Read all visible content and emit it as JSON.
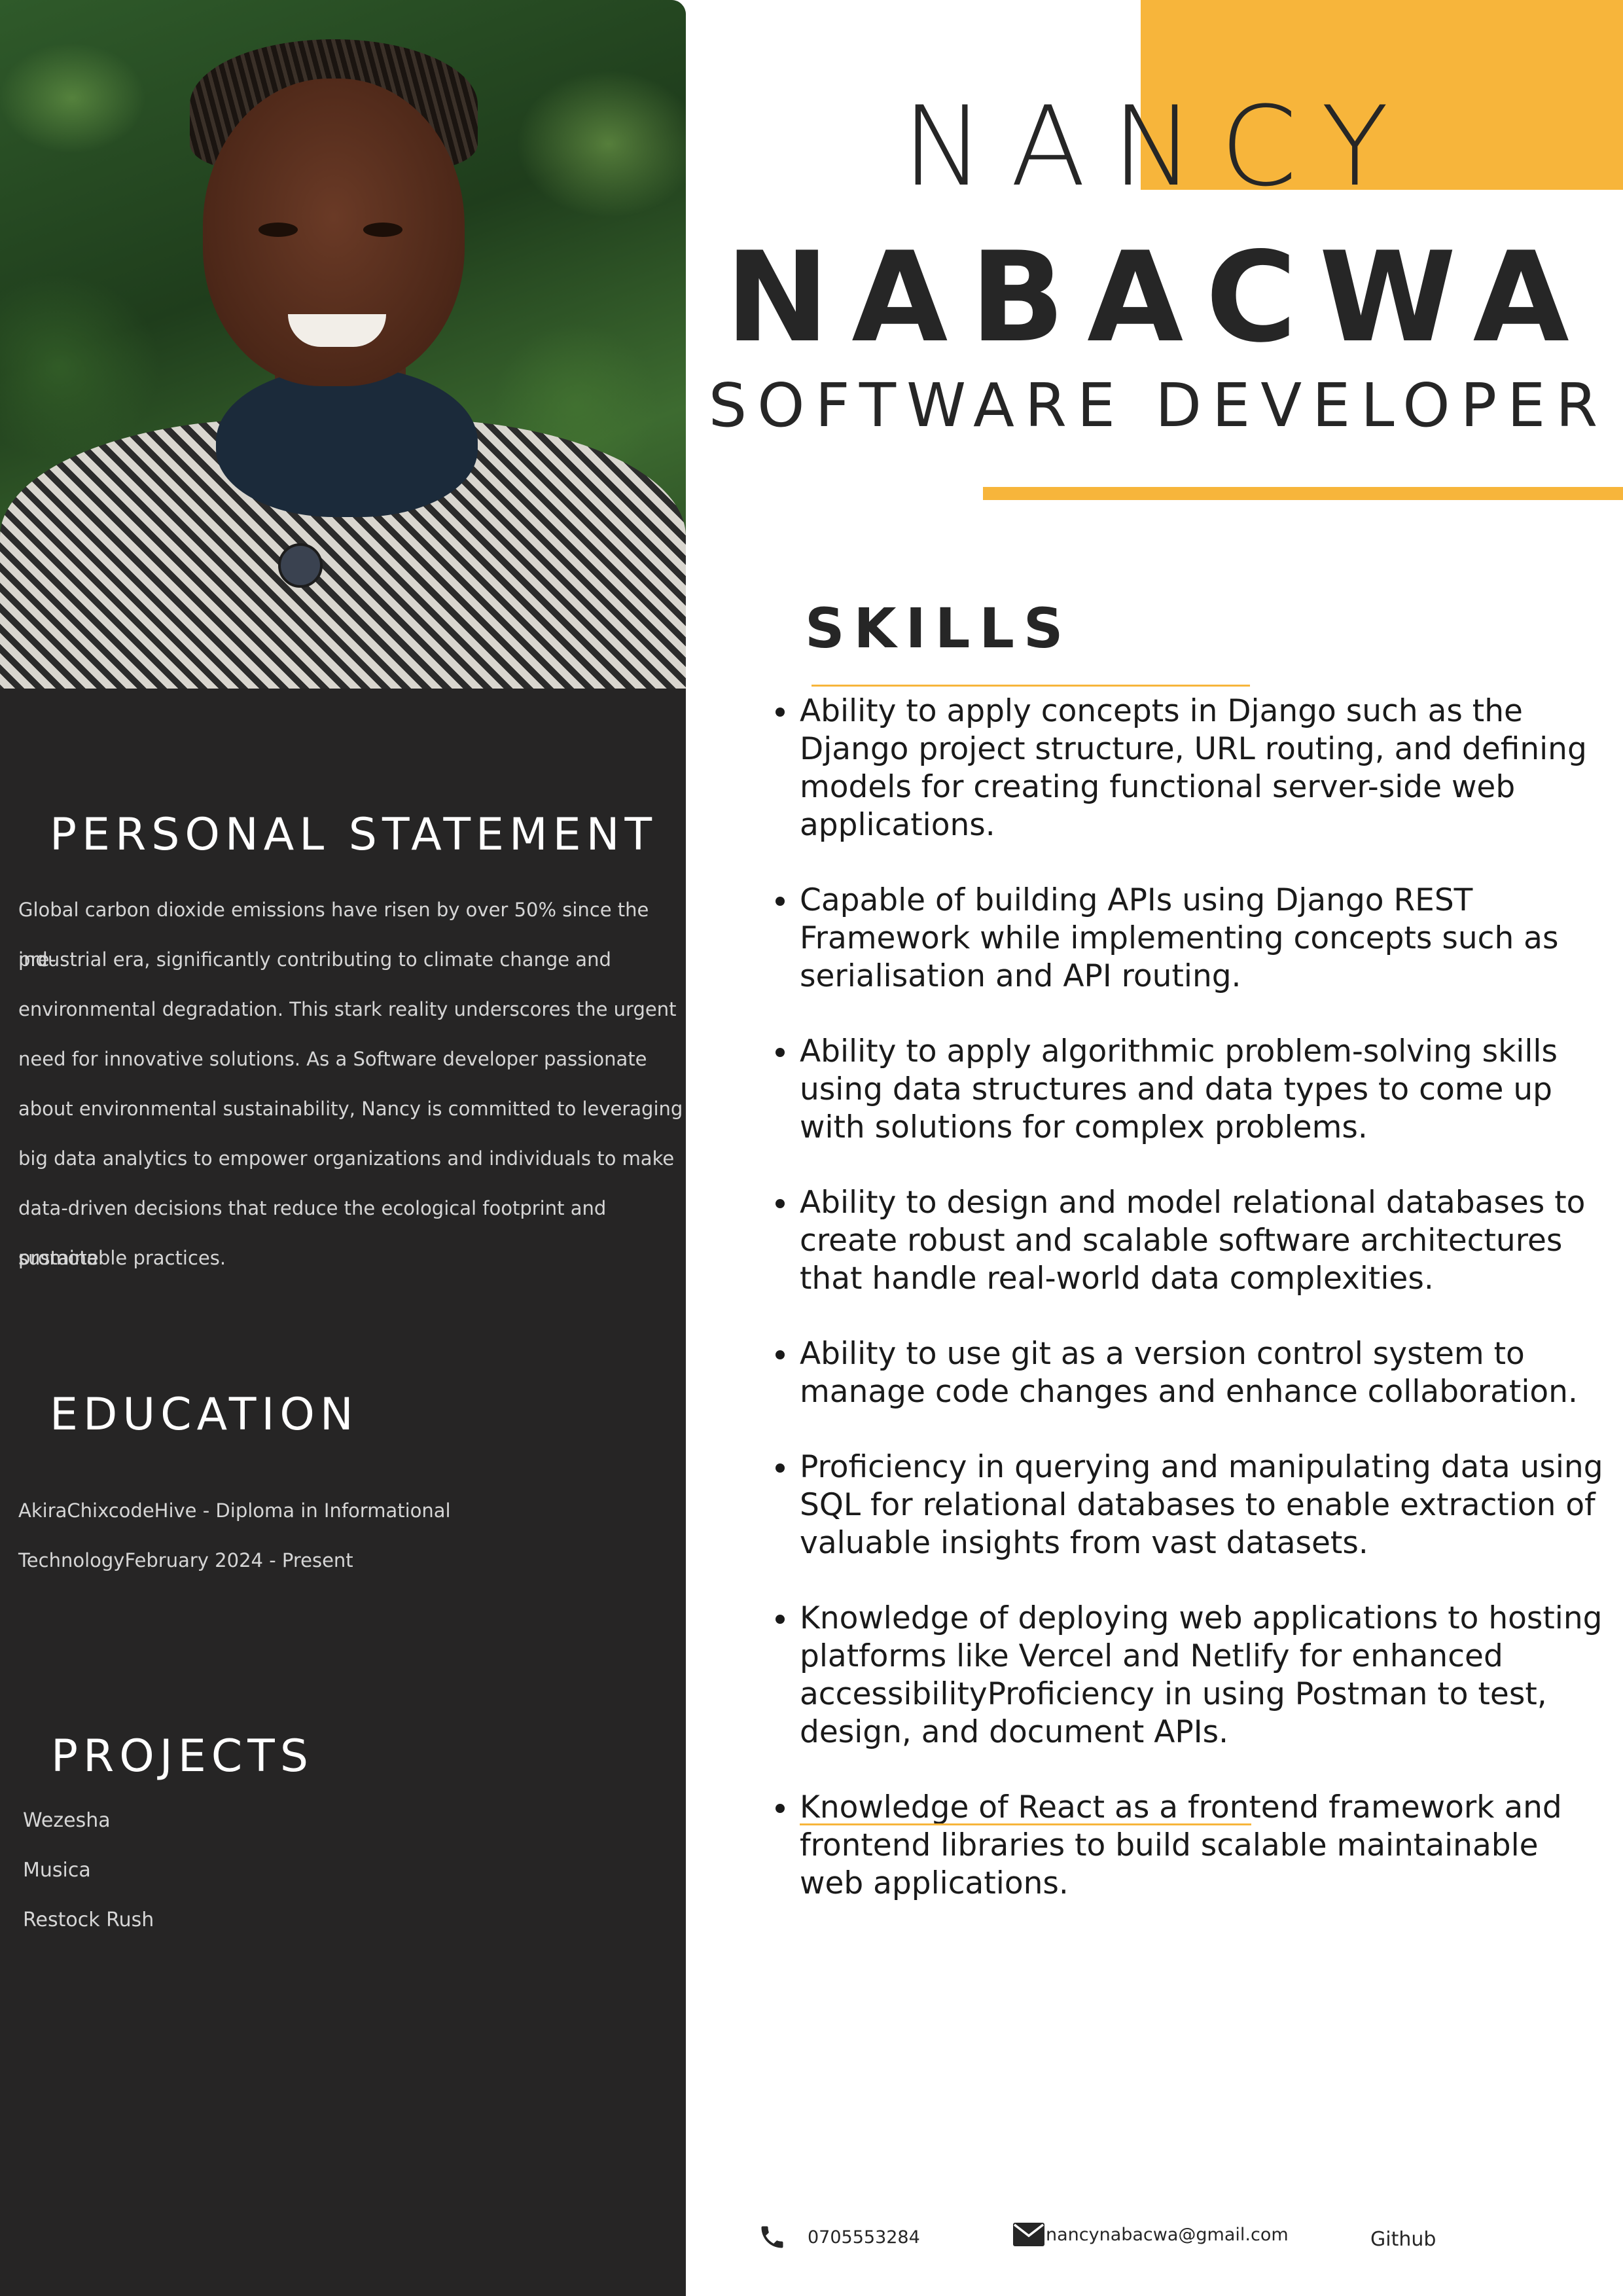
{
  "profile": {
    "first_name": "NANCY",
    "last_name": "NABACWA",
    "title": "SOFTWARE DEVELOPER"
  },
  "personal_statement": {
    "heading": "PERSONAL STATEMENT",
    "lines": [
      "Global carbon dioxide emissions have risen by over 50% since the pre-",
      "industrial era, significantly contributing to climate change and",
      "environmental degradation. This stark reality underscores the urgent",
      "need for innovative solutions. As a Software developer passionate",
      "about environmental sustainability,  Nancy is committed to leveraging",
      "big data analytics to empower organizations and individuals to make",
      "data-driven decisions that reduce the ecological footprint and promote",
      "sustainable practices."
    ]
  },
  "education": {
    "heading": "EDUCATION",
    "lines": [
      "AkiraChixcodeHive - Diploma in Informational",
      "TechnologyFebruary 2024 - Present"
    ]
  },
  "projects": {
    "heading": "PROJECTS",
    "items": [
      "Wezesha",
      "Musica",
      "Restock Rush"
    ]
  },
  "skills": {
    "heading": "SKILLS",
    "items": [
      "Ability to apply concepts in Django such as the Django project structure, URL routing, and defining models for creating functional server-side web applications.",
      "Capable of building APIs using Django REST Framework while implementing concepts such as serialisation and API routing.",
      "Ability to apply algorithmic problem-solving skills using data structures and data types to come up with solutions for complex problems.",
      "Ability to design and model relational databases to create robust and scalable software architectures that handle real-world data complexities.",
      "Ability to use git as a version control system to manage code changes and enhance collaboration.",
      "Proficiency in querying and manipulating data using SQL for relational databases to enable extraction of valuable insights from vast datasets.",
      "Knowledge of deploying web applications to hosting platforms like Vercel and Netlify for enhanced accessibilityProficiency in using Postman to test, design, and document APIs.",
      "Knowledge of React as a frontend framework and frontend libraries to build scalable maintainable web applications."
    ]
  },
  "contact": {
    "phone": "0705553284",
    "email": "nancynabacwa@gmail.com",
    "github": "Github"
  },
  "colors": {
    "accent": "#f7b53b",
    "sidebar": "#262525",
    "text": "#262626"
  },
  "icons": {
    "phone": "phone-icon",
    "email": "envelope-icon"
  }
}
